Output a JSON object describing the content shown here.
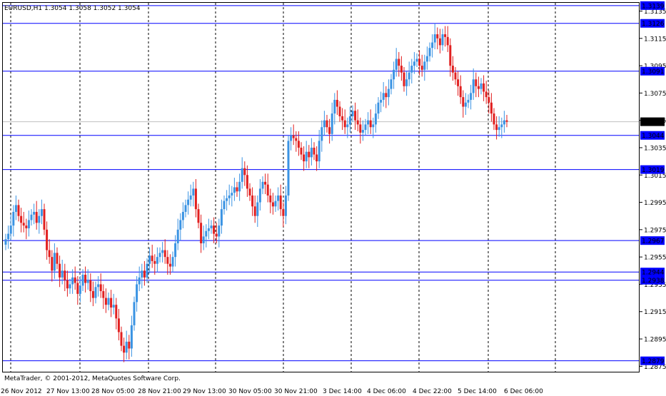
{
  "header": {
    "symbol_text": "EURUSD,H1  1.3054 1.3058 1.3052 1.3054"
  },
  "copyright": "MetaTrader, © 2001-2012, MetaQuotes Software Corp.",
  "colors": {
    "background": "#ffffff",
    "bull_candle": "#3a93e3",
    "bear_candle": "#e11f1f",
    "level_line": "#0000ff",
    "level_label_bg": "#0000ff",
    "level_label_text": "#ffffff",
    "current_price_bg": "#000000",
    "current_price_line": "#c0c0c0",
    "grid": "#000000"
  },
  "chart_data": {
    "type": "candlestick",
    "symbol": "EURUSD",
    "timeframe": "H1",
    "ohlc_current": {
      "open": 1.3054,
      "high": 1.3058,
      "low": 1.3052,
      "close": 1.3054
    },
    "y_range": [
      1.2871,
      1.3141
    ],
    "y_ticks": [
      "1.3135",
      "1.3115",
      "1.3095",
      "1.3075",
      "1.3055",
      "1.3035",
      "1.3015",
      "1.2995",
      "1.2975",
      "1.2955",
      "1.2935",
      "1.2915",
      "1.2895",
      "1.2875"
    ],
    "x_labels": [
      "26 Nov 2012",
      "27 Nov 13:00",
      "28 Nov 05:00",
      "28 Nov 21:00",
      "29 Nov 13:00",
      "30 Nov 05:00",
      "30 Nov 21:00",
      "3 Dec 14:00",
      "4 Dec 06:00",
      "4 Dec 22:00",
      "5 Dec 14:00",
      "6 Dec 06:00"
    ],
    "levels": [
      "1.3139",
      "1.3126",
      "1.3091",
      "1.3044",
      "1.3019",
      "1.2967",
      "1.2944",
      "1.2938",
      "1.2879"
    ],
    "current_price": "1.3054",
    "candles_closes": [
      1.2968,
      1.2972,
      1.2978,
      1.2988,
      1.2993,
      1.2985,
      1.298,
      1.2978,
      1.2976,
      1.2982,
      1.2986,
      1.2988,
      1.298,
      1.2985,
      1.299,
      1.2975,
      1.296,
      1.2955,
      1.2945,
      1.2958,
      1.295,
      1.294,
      1.2945,
      1.2938,
      1.2932,
      1.2935,
      1.294,
      1.2936,
      1.2928,
      1.2934,
      1.2942,
      1.2936,
      1.2938,
      1.293,
      1.2925,
      1.2933,
      1.2935,
      1.293,
      1.2925,
      1.292,
      1.2925,
      1.2918,
      1.292,
      1.291,
      1.29,
      1.289,
      1.2885,
      1.2893,
      1.2888,
      1.2905,
      1.2922,
      1.2935,
      1.294,
      1.2945,
      1.294,
      1.295,
      1.2956,
      1.2952,
      1.295,
      1.2955,
      1.2958,
      1.296,
      1.2955,
      1.295,
      1.2948,
      1.2955,
      1.2965,
      1.2975,
      1.2982,
      1.2988,
      1.2993,
      1.2997,
      1.3,
      1.3005,
      1.299,
      1.298,
      1.2965,
      1.297,
      1.2974,
      1.2976,
      1.2978,
      1.2972,
      1.297,
      1.2978,
      1.299,
      1.2996,
      1.2998,
      1.3,
      1.3002,
      1.3006,
      1.3003,
      1.301,
      1.302,
      1.3015,
      1.3005,
      1.3,
      1.2992,
      1.2985,
      1.2995,
      1.3005,
      1.301,
      1.3008,
      1.3,
      1.2995,
      1.2992,
      1.2996,
      1.3,
      1.299,
      1.2985,
      1.3,
      1.304,
      1.3044,
      1.3042,
      1.304,
      1.3035,
      1.303,
      1.3025,
      1.3032,
      1.3028,
      1.3035,
      1.303,
      1.3025,
      1.304,
      1.305,
      1.3055,
      1.305,
      1.3045,
      1.306,
      1.307,
      1.3065,
      1.3058,
      1.3055,
      1.305,
      1.3052,
      1.3058,
      1.3062,
      1.3055,
      1.3052,
      1.3046,
      1.3048,
      1.3052,
      1.3055,
      1.305,
      1.3052,
      1.306,
      1.3068,
      1.307,
      1.3075,
      1.3072,
      1.3078,
      1.3085,
      1.3092,
      1.31,
      1.3095,
      1.309,
      1.308,
      1.3085,
      1.309,
      1.3095,
      1.3098,
      1.31,
      1.3095,
      1.3092,
      1.3098,
      1.3102,
      1.3108,
      1.3112,
      1.3118,
      1.3115,
      1.311,
      1.3118,
      1.3116,
      1.311,
      1.3095,
      1.309,
      1.3085,
      1.308,
      1.3072,
      1.3065,
      1.3068,
      1.307,
      1.3075,
      1.3085,
      1.308,
      1.3078,
      1.3082,
      1.3076,
      1.3072,
      1.3068,
      1.306,
      1.3052,
      1.3048,
      1.305,
      1.3052,
      1.3055,
      1.3054
    ],
    "candles_count_note": ""
  }
}
